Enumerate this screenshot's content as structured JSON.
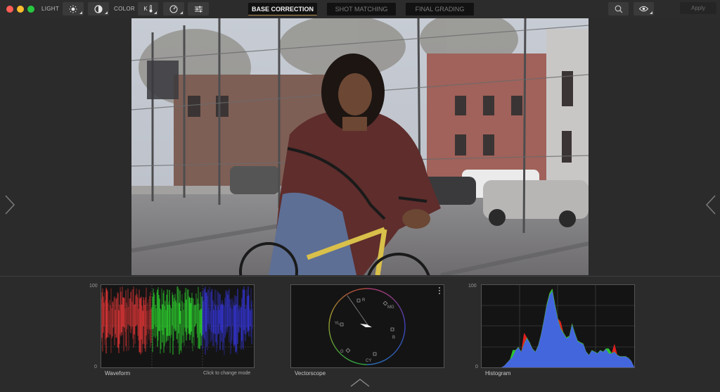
{
  "window": {
    "controls": [
      "close",
      "minimize",
      "maximize"
    ]
  },
  "toolbar": {
    "light_label": "LIGHT",
    "color_label": "COLOR",
    "light_buttons": [
      {
        "icon": "brightness-icon"
      },
      {
        "icon": "contrast-icon"
      }
    ],
    "color_buttons": [
      {
        "icon": "temperature-icon",
        "glyph": "K"
      },
      {
        "icon": "tint-dial-icon"
      },
      {
        "icon": "sliders-icon"
      }
    ],
    "tabs": [
      {
        "label": "BASE CORRECTION",
        "active": true
      },
      {
        "label": "SHOT MATCHING",
        "active": false
      },
      {
        "label": "FINAL GRADING",
        "active": false
      }
    ],
    "search_icon": "search-icon",
    "view_icon": "eye-icon",
    "apply_label": "Apply"
  },
  "viewer": {
    "image_description": "Young woman with curly hair in a maroon sweater sitting on a yellow BMX bike by a chain-link fence, brick buildings and parked cars behind",
    "prev_icon": "chevron-right-icon",
    "next_icon": "chevron-left-icon"
  },
  "scopes": {
    "waveform": {
      "title": "Waveform",
      "hint": "Click to change mode",
      "axis_max": "100",
      "axis_min": "0",
      "colors": {
        "red": "#ff3b3b",
        "green": "#33ff33",
        "blue": "#3b3bff"
      }
    },
    "vectorscope": {
      "title": "Vectorscope",
      "menu_icon": "more-vertical-icon",
      "targets": [
        "R",
        "MG",
        "B",
        "CY",
        "G",
        "YL"
      ]
    },
    "histogram": {
      "title": "Histogram",
      "axis_max": "100",
      "axis_min": "0",
      "colors": {
        "red": "#e02020",
        "green": "#2ec42e",
        "blue": "#4466dd"
      }
    }
  },
  "panel_toggle_icon": "chevron-up-icon"
}
